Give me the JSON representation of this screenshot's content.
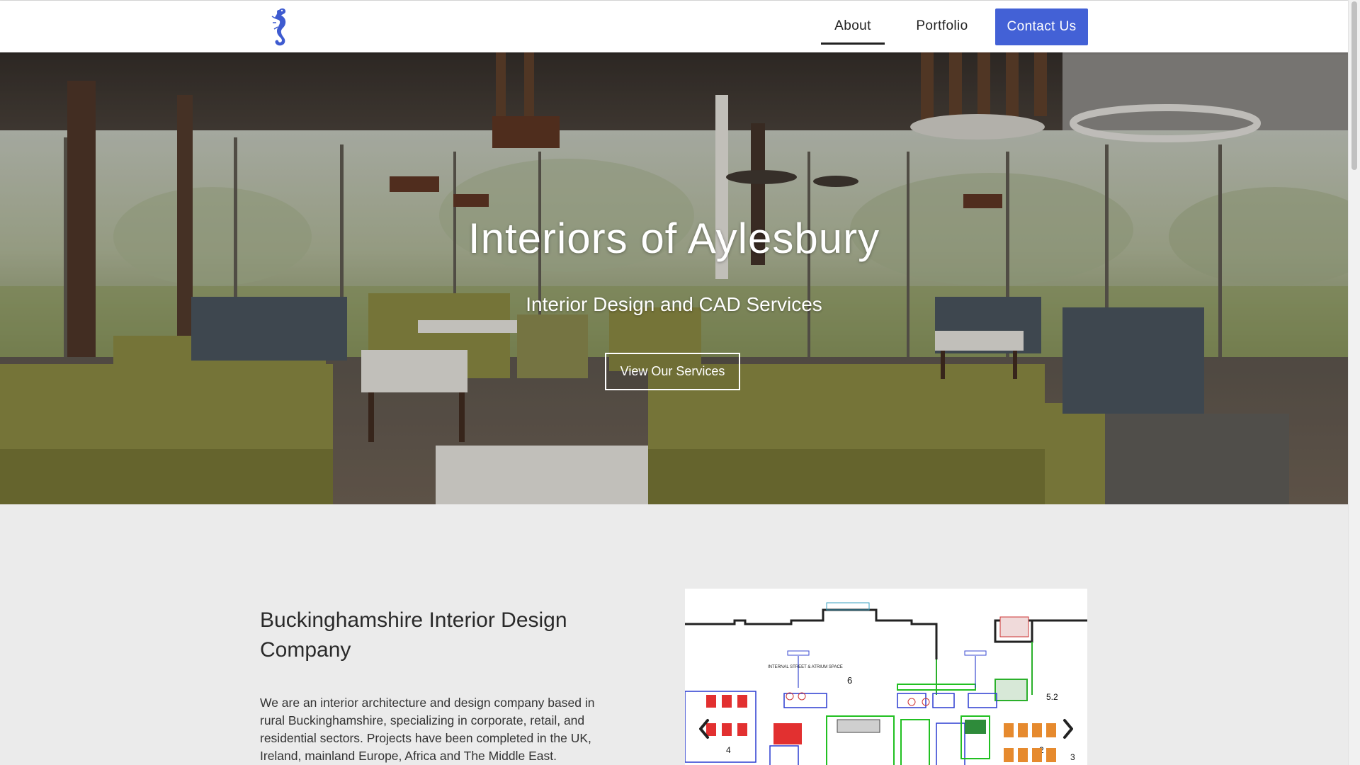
{
  "nav": {
    "logo_icon": "seahorse-logo-icon",
    "about_label": "About",
    "portfolio_label": "Portfolio",
    "contact_label": "Contact Us"
  },
  "hero": {
    "title": "Interiors of Aylesbury",
    "subtitle": "Interior Design and CAD Services",
    "cta_label": "View Our Services"
  },
  "intro": {
    "heading": "Buckinghamshire Interior Design Company",
    "body": "We are an interior architecture and design company based in rural Buckinghamshire, specializing in corporate, retail, and residential sectors. Projects have been completed in the UK, Ireland, mainland Europe, Africa and The Middle East."
  },
  "carousel": {
    "image": "floor-plan-drawing",
    "plan_label": "INTERNAL STREET & ATRIUM SPACE",
    "prev_icon": "chevron-left-icon",
    "next_icon": "chevron-right-icon"
  },
  "colors": {
    "accent": "#4361d6",
    "background": "#ebebeb",
    "nav_background": "#ffffff"
  }
}
